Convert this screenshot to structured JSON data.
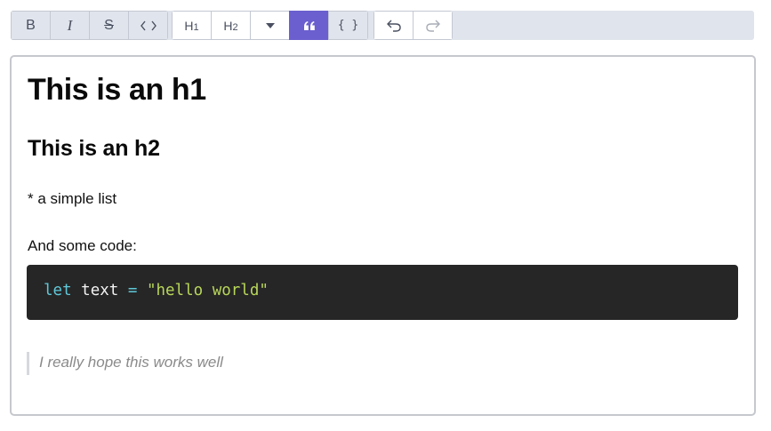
{
  "toolbar": {
    "buttons": [
      {
        "name": "bold",
        "label": "B"
      },
      {
        "name": "italic",
        "label": "I"
      },
      {
        "name": "strikethrough",
        "label": "S"
      },
      {
        "name": "inline-code",
        "label": "<>"
      },
      {
        "name": "heading-1",
        "label": "H1"
      },
      {
        "name": "heading-2",
        "label": "H2"
      },
      {
        "name": "more-headings",
        "icon": "caret-down-icon"
      },
      {
        "name": "blockquote",
        "icon": "quote-icon",
        "active": true
      },
      {
        "name": "code-block",
        "label": "{ }"
      },
      {
        "name": "undo",
        "icon": "undo-icon"
      },
      {
        "name": "redo",
        "icon": "redo-icon",
        "disabled": true
      }
    ],
    "colors": {
      "bar": "#e0e4ec",
      "active": "#6b5fcf"
    }
  },
  "editor": {
    "h1": "This is an h1",
    "h2": "This is an h2",
    "list_line": "* a simple list",
    "code_intro": "And some code:",
    "code": {
      "keyword": "let",
      "identifier": "text",
      "operator": "=",
      "string": "\"hello world\""
    },
    "quote": "I really hope this works well"
  }
}
